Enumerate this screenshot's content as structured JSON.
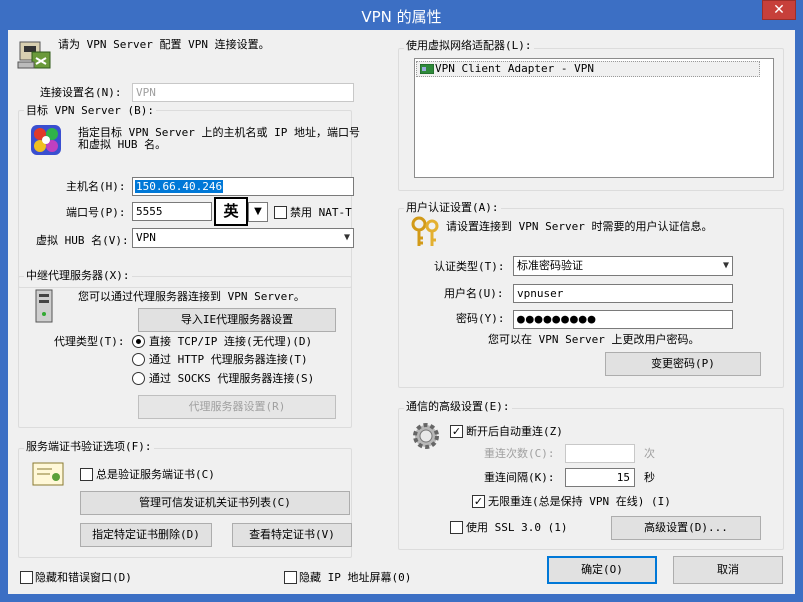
{
  "window": {
    "title": "VPN 的属性",
    "close": "✕"
  },
  "intro": {
    "text": "请为 VPN Server 配置 VPN 连接设置。"
  },
  "conn": {
    "label": "连接设置名(N):",
    "value": "VPN"
  },
  "target": {
    "group": "目标 VPN Server (B):",
    "desc1": "指定目标 VPN Server 上的主机名或 IP 地址，端口号",
    "desc2": "和虚拟 HUB 名。",
    "host_label": "主机名(H):",
    "host_value": "150.66.40.246",
    "port_label": "端口号(P):",
    "port_value": "5555",
    "ime": "英",
    "nat_label": "禁用 NAT-T",
    "hub_label": "虚拟 HUB 名(V):",
    "hub_value": "VPN"
  },
  "proxy": {
    "group": "中继代理服务器(X):",
    "desc": "您可以通过代理服务器连接到 VPN Server。",
    "import_btn": "导入IE代理服务器设置",
    "type_label": "代理类型(T):",
    "options": [
      "直接 TCP/IP 连接(无代理)(D)",
      "通过 HTTP 代理服务器连接(T)",
      "通过 SOCKS 代理服务器连接(S)"
    ],
    "settings_btn": "代理服务器设置(R)"
  },
  "cert": {
    "group": "服务端证书验证选项(F):",
    "verify_label": "总是验证服务端证书(C)",
    "manage_btn": "管理可信发证机关证书列表(C)",
    "delete_btn": "指定特定证书删除(D)",
    "view_btn": "查看特定证书(V)"
  },
  "bottom": {
    "hide_err": "隐藏和错误窗口(D)",
    "hide_ip": "隐藏 IP 地址屏幕(0)",
    "ok": "确定(O)",
    "cancel": "取消"
  },
  "adapter": {
    "group": "使用虚拟网络适配器(L):",
    "item": "VPN Client Adapter - VPN"
  },
  "auth": {
    "group": "用户认证设置(A):",
    "desc": "请设置连接到 VPN Server 时需要的用户认证信息。",
    "type_label": "认证类型(T):",
    "type_value": "标准密码验证",
    "user_label": "用户名(U):",
    "user_value": "vpnuser",
    "pass_label": "密码(Y):",
    "pass_value": "●●●●●●●●●",
    "change_hint": "您可以在 VPN Server 上更改用户密码。",
    "change_btn": "变更密码(P)"
  },
  "adv": {
    "group": "通信的高级设置(E):",
    "reconnect_label": "断开后自动重连(Z)",
    "count_label": "重连次数(C):",
    "count_unit": "次",
    "interval_label": "重连间隔(K):",
    "interval_value": "15",
    "interval_unit": "秒",
    "infinite_label": "无限重连(总是保持 VPN 在线) (I)",
    "ssl_label": "使用 SSL 3.0 (1)",
    "adv_btn": "高级设置(D)..."
  }
}
